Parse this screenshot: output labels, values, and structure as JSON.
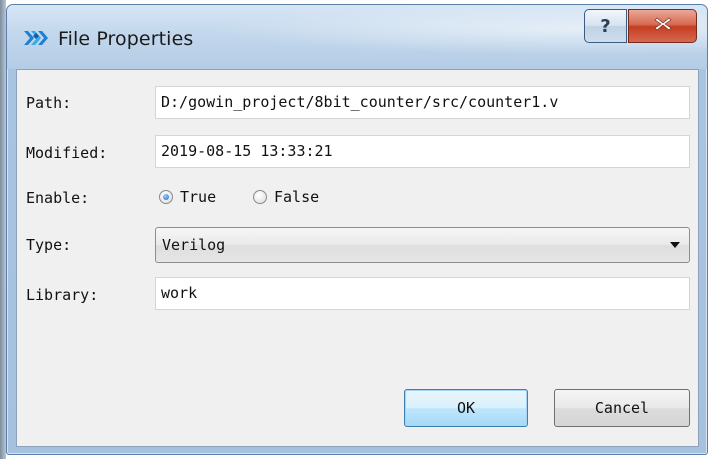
{
  "window": {
    "title": "File Properties",
    "icon": "gowin-logo-icon",
    "help_glyph": "?",
    "close_glyph": "✕"
  },
  "form": {
    "path": {
      "label": "Path:",
      "value": "D:/gowin_project/8bit_counter/src/counter1.v"
    },
    "modified": {
      "label": "Modified:",
      "value": "2019-08-15 13:33:21"
    },
    "enable": {
      "label": "Enable:",
      "options": [
        {
          "label": "True",
          "checked": true
        },
        {
          "label": "False",
          "checked": false
        }
      ]
    },
    "type": {
      "label": "Type:",
      "value": "Verilog"
    },
    "library": {
      "label": "Library:",
      "value": "work"
    }
  },
  "buttons": {
    "ok": "OK",
    "cancel": "Cancel"
  },
  "colors": {
    "accent": "#3c7fb1",
    "close": "#c43d22",
    "frame": "#a9c4e1",
    "logo": "#2a8fd6"
  }
}
